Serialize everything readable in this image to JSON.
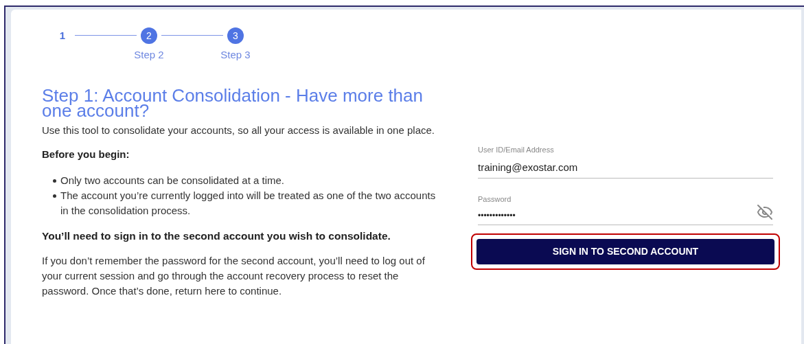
{
  "stepper": [
    {
      "number": "1",
      "selected": true
    },
    {
      "number": "2",
      "label": "Step 2",
      "selected": false
    },
    {
      "number": "3",
      "label": "Step 3",
      "selected": false
    }
  ],
  "heading": "Step 1: Account Consolidation - Have more than one account?",
  "intro": "Use this tool to consolidate your accounts, so all your access is available in one place.",
  "before_heading": "Before you begin:",
  "bullets": [
    "Only two accounts can be consolidated at a time.",
    "The account you’re currently logged into will be treated as one of the two accounts in the consolidation process."
  ],
  "notice": "You’ll need to sign in to the second account you wish to consolidate.",
  "help": "If you don’t remember the password for the second account, you’ll need to log out of your current session and go through the account recovery process to reset the password. Once that’s done, return here to continue.",
  "form": {
    "user_field": {
      "label": "User ID/Email Address",
      "value": "training@exostar.com"
    },
    "password_field": {
      "label": "Password",
      "value": "•••••••••••••",
      "revealed": false
    },
    "submit": {
      "label": "SIGN IN TO SECOND ACCOUNT",
      "highlighted": true
    }
  }
}
